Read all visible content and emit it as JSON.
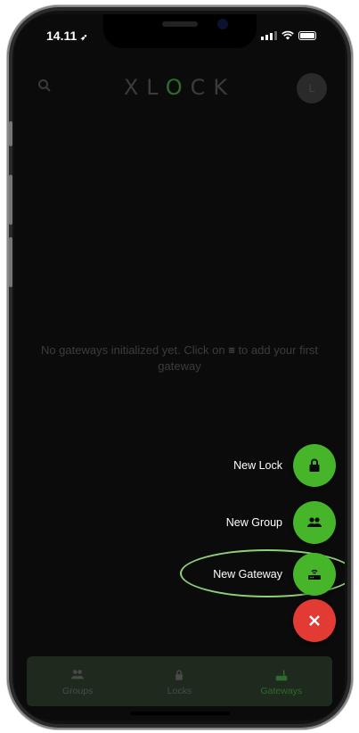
{
  "status_bar": {
    "time": "14.11"
  },
  "app_bar": {
    "logo_left": "XL",
    "logo_o": "O",
    "logo_right": "CK",
    "avatar_initial": "L"
  },
  "empty_message": {
    "before_icon": "No gateways initialized yet. Click on",
    "after_icon": "to add your first gateway"
  },
  "fab_menu": {
    "items": [
      {
        "label": "New Lock",
        "icon": "lock-icon"
      },
      {
        "label": "New Group",
        "icon": "group-icon"
      },
      {
        "label": "New Gateway",
        "icon": "router-icon"
      }
    ],
    "close_icon": "close-icon"
  },
  "bottom_nav": {
    "items": [
      {
        "label": "Groups",
        "icon": "group-icon",
        "active": false
      },
      {
        "label": "Locks",
        "icon": "lock-icon",
        "active": false
      },
      {
        "label": "Gateways",
        "icon": "router-icon",
        "active": true
      }
    ]
  },
  "colors": {
    "fab_green": "#46b52a",
    "close_red": "#e23b33",
    "highlight_ring": "#8ed07a",
    "active_nav": "#2e6b2e"
  }
}
